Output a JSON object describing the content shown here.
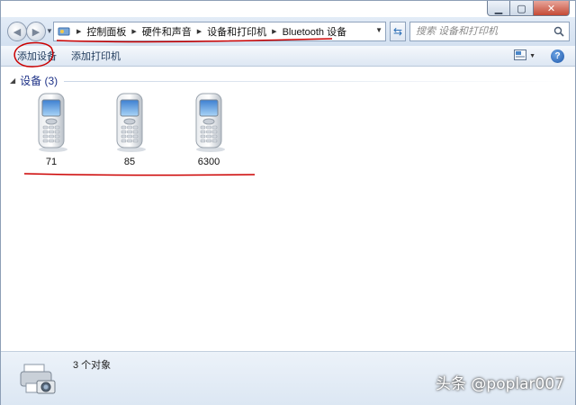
{
  "address": {
    "breadcrumbs": [
      "控制面板",
      "硬件和声音",
      "设备和打印机",
      "Bluetooth 设备"
    ]
  },
  "search": {
    "placeholder": "搜索 设备和打印机"
  },
  "toolbar": {
    "add_device": "添加设备",
    "add_printer": "添加打印机"
  },
  "group": {
    "title": "设备 (3)"
  },
  "devices": [
    {
      "label": "71",
      "icon": "mobile-phone-icon"
    },
    {
      "label": "85",
      "icon": "mobile-phone-icon"
    },
    {
      "label": "6300",
      "icon": "mobile-phone-icon"
    }
  ],
  "status": {
    "count_text": "3 个对象",
    "icon": "printer-camera-icon"
  },
  "watermark": "头条 @poplar007",
  "colors": {
    "annotation": "#cc0000",
    "group_title": "#1e3287"
  }
}
